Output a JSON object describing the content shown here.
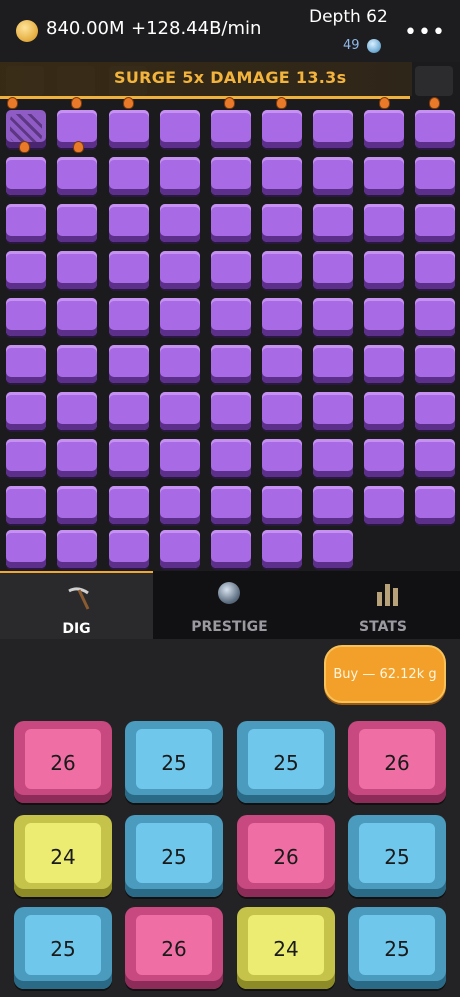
{
  "hud": {
    "gold": "840.00M",
    "rate": "+128.44B/min",
    "depth": "Depth 62",
    "gems": "49",
    "more_icon": "more-dots-icon"
  },
  "surge": {
    "text": "SURGE  5x DAMAGE  13.3s",
    "color": "#f2b43c"
  },
  "field": {
    "tile_color": "#a96ae6",
    "rows_full": 9,
    "columns": 9,
    "last_row_count": 7,
    "cracked_tile": "row 1 col 1",
    "miners": 9
  },
  "tabs": [
    {
      "label": "DIG",
      "icon": "pickaxe-icon",
      "active": true
    },
    {
      "label": "PRESTIGE",
      "icon": "prestige-badge-icon",
      "active": false
    },
    {
      "label": "STATS",
      "icon": "stats-bars-icon",
      "active": false
    }
  ],
  "buy_button": {
    "label": "Buy — 62.12k g",
    "color": "#f2a02a"
  },
  "keys": [
    {
      "value": "26",
      "color": "pink"
    },
    {
      "value": "25",
      "color": "blue"
    },
    {
      "value": "25",
      "color": "blue"
    },
    {
      "value": "26",
      "color": "pink"
    },
    {
      "value": "24",
      "color": "yellow"
    },
    {
      "value": "25",
      "color": "blue"
    },
    {
      "value": "26",
      "color": "pink"
    },
    {
      "value": "25",
      "color": "blue"
    },
    {
      "value": "25",
      "color": "blue"
    },
    {
      "value": "26",
      "color": "pink"
    },
    {
      "value": "24",
      "color": "yellow"
    },
    {
      "value": "25",
      "color": "blue"
    }
  ]
}
